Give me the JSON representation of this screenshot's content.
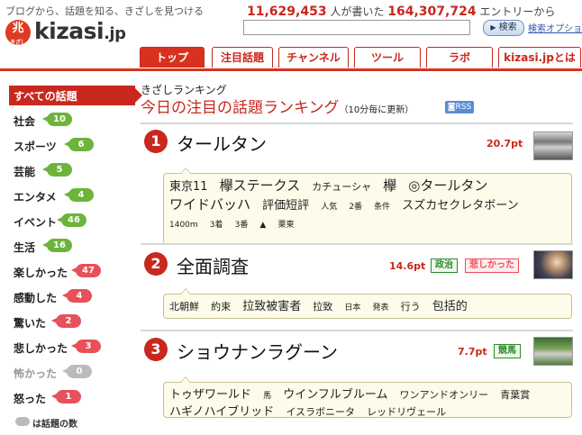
{
  "header": {
    "tagline": "ブログから、話題を知る、きざしを見つける",
    "logo": {
      "mark": "兆",
      "mark_sub": "きざし",
      "text": "kizasi",
      "tld": ".jp"
    },
    "stats": {
      "writers": "11,629,453",
      "writers_label": "人が書いた",
      "entries": "164,307,724",
      "entries_label": "エントリーから"
    },
    "search": {
      "value": "",
      "button_label": "検索",
      "options_link": "検索オプション"
    }
  },
  "tabs": [
    {
      "label": "トップ",
      "active": true
    },
    {
      "label": "注目話題",
      "active": false
    },
    {
      "label": "チャンネル",
      "active": false
    },
    {
      "label": "ツール",
      "active": false
    },
    {
      "label": "ラボ",
      "active": false
    },
    {
      "label": "kizasi.jpとは",
      "active": false
    }
  ],
  "sidebar": {
    "items": [
      {
        "label": "すべての話題",
        "count": "",
        "color": ""
      },
      {
        "label": "社会",
        "count": "10",
        "color": "#6cb43a"
      },
      {
        "label": "スポーツ",
        "count": "6",
        "color": "#6cb43a"
      },
      {
        "label": "芸能",
        "count": "5",
        "color": "#6cb43a"
      },
      {
        "label": "エンタメ",
        "count": "4",
        "color": "#6cb43a"
      },
      {
        "label": "イベント",
        "count": "46",
        "color": "#6cb43a"
      },
      {
        "label": "生活",
        "count": "16",
        "color": "#6cb43a"
      },
      {
        "label": "楽しかった",
        "count": "47",
        "color": "#e8505a"
      },
      {
        "label": "感動した",
        "count": "4",
        "color": "#e8505a"
      },
      {
        "label": "驚いた",
        "count": "2",
        "color": "#e8505a"
      },
      {
        "label": "悲しかった",
        "count": "3",
        "color": "#e8505a"
      },
      {
        "label": "怖かった",
        "count": "0",
        "color": "#bbbbbb"
      },
      {
        "label": "怒った",
        "count": "1",
        "color": "#e8505a"
      }
    ],
    "legend": "は話題の数"
  },
  "main": {
    "kicker": "きざしランキング",
    "title": "今日の注目の話題ランキング",
    "subtitle": "（10分毎に更新）",
    "rss": "RSS",
    "rankings": [
      {
        "rank": "1",
        "title": "タールタン",
        "points": "20.7pt",
        "badges": [],
        "keywords": [
          {
            "t": "東京11",
            "s": "m"
          },
          {
            "t": "欅ステークス",
            "s": "l"
          },
          {
            "t": "カチューシャ",
            "s": "s"
          },
          {
            "t": "欅",
            "s": "l"
          },
          {
            "t": "◎タールタン",
            "s": "l"
          },
          {
            "t": "ワイドバッハ",
            "s": "l"
          },
          {
            "t": "評価短評",
            "s": "m"
          },
          {
            "t": "人気",
            "s": "xs"
          },
          {
            "t": "2番",
            "s": "xs"
          },
          {
            "t": "条件",
            "s": "xs"
          },
          {
            "t": "スズカセクレタボーン",
            "s": "m"
          },
          {
            "t": "1400m",
            "s": "xs"
          },
          {
            "t": "3着",
            "s": "xs"
          },
          {
            "t": "3番",
            "s": "xs"
          },
          {
            "t": "▲",
            "s": "xs"
          },
          {
            "t": "栗東",
            "s": "xs"
          }
        ]
      },
      {
        "rank": "2",
        "title": "全面調査",
        "points": "14.6pt",
        "badges": [
          {
            "label": "政治",
            "color": "#2f8a2f"
          },
          {
            "label": "悲しかった",
            "color": "#e8505a"
          }
        ],
        "keywords": [
          {
            "t": "北朝鮮",
            "s": "s"
          },
          {
            "t": "約束",
            "s": "s"
          },
          {
            "t": "拉致被害者",
            "s": "m"
          },
          {
            "t": "拉致",
            "s": "s"
          },
          {
            "t": "日本",
            "s": "xs"
          },
          {
            "t": "発表",
            "s": "xs"
          },
          {
            "t": "行う",
            "s": "s"
          },
          {
            "t": "包括的",
            "s": "m"
          }
        ]
      },
      {
        "rank": "3",
        "title": "ショウナンラグーン",
        "points": "7.7pt",
        "badges": [
          {
            "label": "競馬",
            "color": "#2f8a2f"
          }
        ],
        "keywords": [
          {
            "t": "トゥザワールド",
            "s": "m"
          },
          {
            "t": "馬",
            "s": "xs"
          },
          {
            "t": "ウインフルブルーム",
            "s": "m"
          },
          {
            "t": "ワンアンドオンリー",
            "s": "s"
          },
          {
            "t": "青葉賞",
            "s": "s"
          },
          {
            "t": "ハギノハイブリッド",
            "s": "m"
          },
          {
            "t": "イスラボニータ",
            "s": "s"
          },
          {
            "t": "レッドリヴェール",
            "s": "s"
          }
        ]
      }
    ]
  }
}
